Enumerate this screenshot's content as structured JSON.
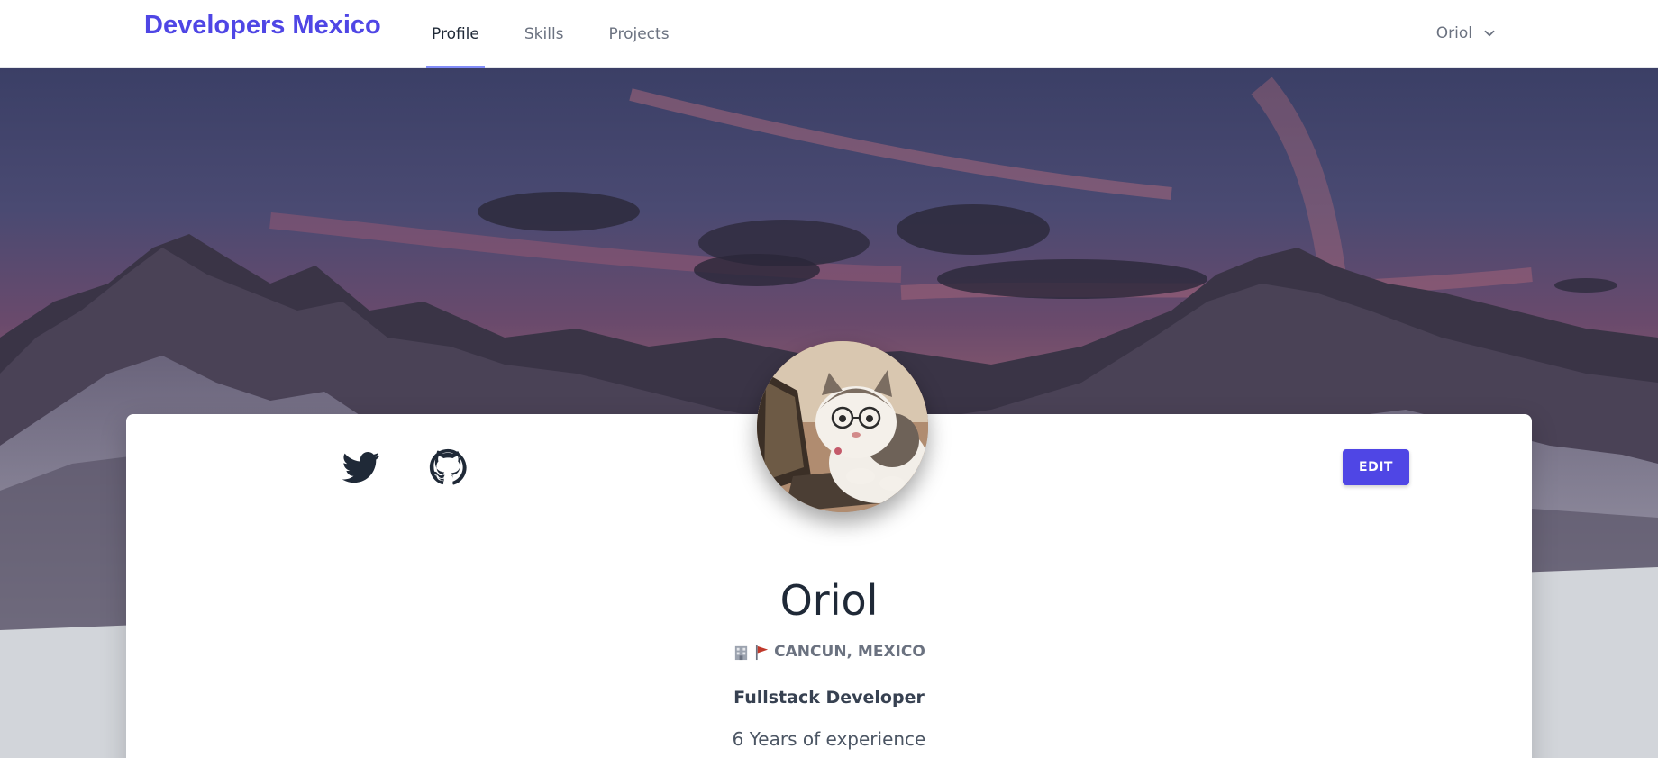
{
  "navbar": {
    "brand": "Developers Mexico",
    "tabs": [
      {
        "label": "Profile",
        "active": true
      },
      {
        "label": "Skills",
        "active": false
      },
      {
        "label": "Projects",
        "active": false
      }
    ],
    "user": {
      "name": "Oriol",
      "icon": "chevron-down-icon"
    }
  },
  "profile": {
    "name": "Oriol",
    "location": "CANCUN, MEXICO",
    "location_icons": [
      "office-building-icon",
      "flag-icon"
    ],
    "role": "Fullstack Developer",
    "experience": "6 Years of experience",
    "edit_label": "EDIT",
    "socials": [
      {
        "name": "twitter-icon"
      },
      {
        "name": "github-icon"
      }
    ]
  },
  "colors": {
    "accent": "#4f46e5",
    "tab_underline": "#818cf8",
    "background": "#d2d5da"
  }
}
